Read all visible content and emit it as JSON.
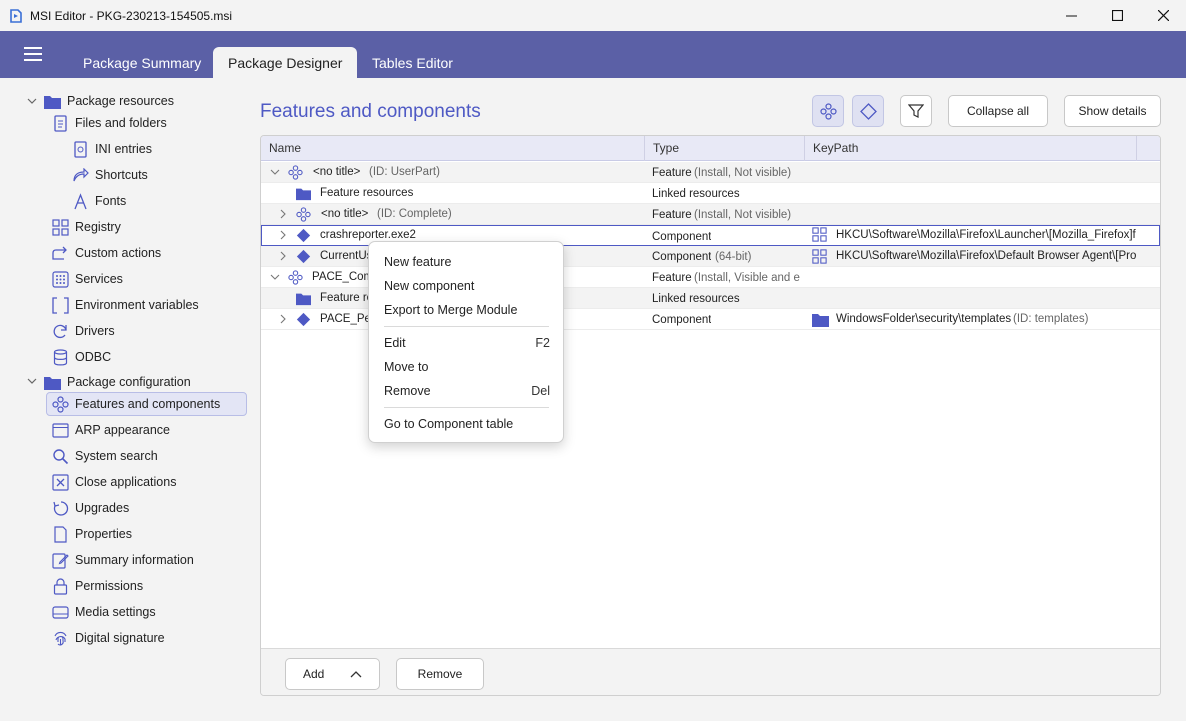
{
  "window": {
    "title": "MSI Editor - PKG-230213-154505.msi"
  },
  "tabs": [
    {
      "label": "Package Summary",
      "active": false
    },
    {
      "label": "Package Designer",
      "active": true
    },
    {
      "label": "Tables Editor",
      "active": false
    }
  ],
  "sidebar": {
    "group1": "Package resources",
    "group1_items": [
      "Files and folders",
      "INI entries",
      "Shortcuts",
      "Fonts",
      "Registry",
      "Custom actions",
      "Services",
      "Environment variables",
      "Drivers",
      "ODBC"
    ],
    "group2": "Package configuration",
    "group2_items": [
      "Features and components",
      "ARP appearance",
      "System search",
      "Close applications",
      "Upgrades",
      "Properties",
      "Summary information",
      "Permissions",
      "Media settings",
      "Digital signature"
    ]
  },
  "content": {
    "title": "Features and components",
    "collapse_label": "Collapse all",
    "details_label": "Show details"
  },
  "grid": {
    "columns": [
      "Name",
      "Type",
      "KeyPath"
    ],
    "rows": [
      {
        "name": "<no title>",
        "id": "(ID: UserPart)",
        "type": "Feature",
        "type_extra": "(Install, Not visible)",
        "keypath": "",
        "keypath_extra": ""
      },
      {
        "name": "Feature resources",
        "id": "",
        "type": "Linked resources",
        "type_extra": "",
        "keypath": "",
        "keypath_extra": ""
      },
      {
        "name": "<no title>",
        "id": "(ID: Complete)",
        "type": "Feature",
        "type_extra": "(Install, Not visible)",
        "keypath": "",
        "keypath_extra": ""
      },
      {
        "name": "crashreporter.exe2",
        "id": "",
        "type": "Component",
        "type_extra": "",
        "keypath": "HKCU\\Software\\Mozilla\\Firefox\\Launcher\\[Mozilla_Firefox]fire",
        "keypath_extra": ""
      },
      {
        "name": "CurrentUs",
        "id": "",
        "type": "Component",
        "type_extra": "(64-bit)",
        "keypath": "HKCU\\Software\\Mozilla\\Firefox\\Default Browser Agent\\[Progr",
        "keypath_extra": ""
      },
      {
        "name": "PACE_Comp",
        "id": "",
        "type": "Feature",
        "type_extra": "(Install, Visible and exp",
        "keypath": "",
        "keypath_extra": ""
      },
      {
        "name": "Feature re",
        "id": "",
        "type": "Linked resources",
        "type_extra": "",
        "keypath": "",
        "keypath_extra": ""
      },
      {
        "name": "PACE_Pern",
        "id": "",
        "type": "Component",
        "type_extra": "",
        "keypath": "WindowsFolder\\security\\templates",
        "keypath_extra": "(ID: templates)"
      }
    ]
  },
  "footer": {
    "add_label": "Add",
    "remove_label": "Remove"
  },
  "context_menu": {
    "new_feature": "New feature",
    "new_component": "New component",
    "export_merge": "Export to Merge Module",
    "edit": "Edit",
    "edit_shortcut": "F2",
    "move_to": "Move to",
    "remove": "Remove",
    "remove_shortcut": "Del",
    "goto_table": "Go to Component table"
  }
}
